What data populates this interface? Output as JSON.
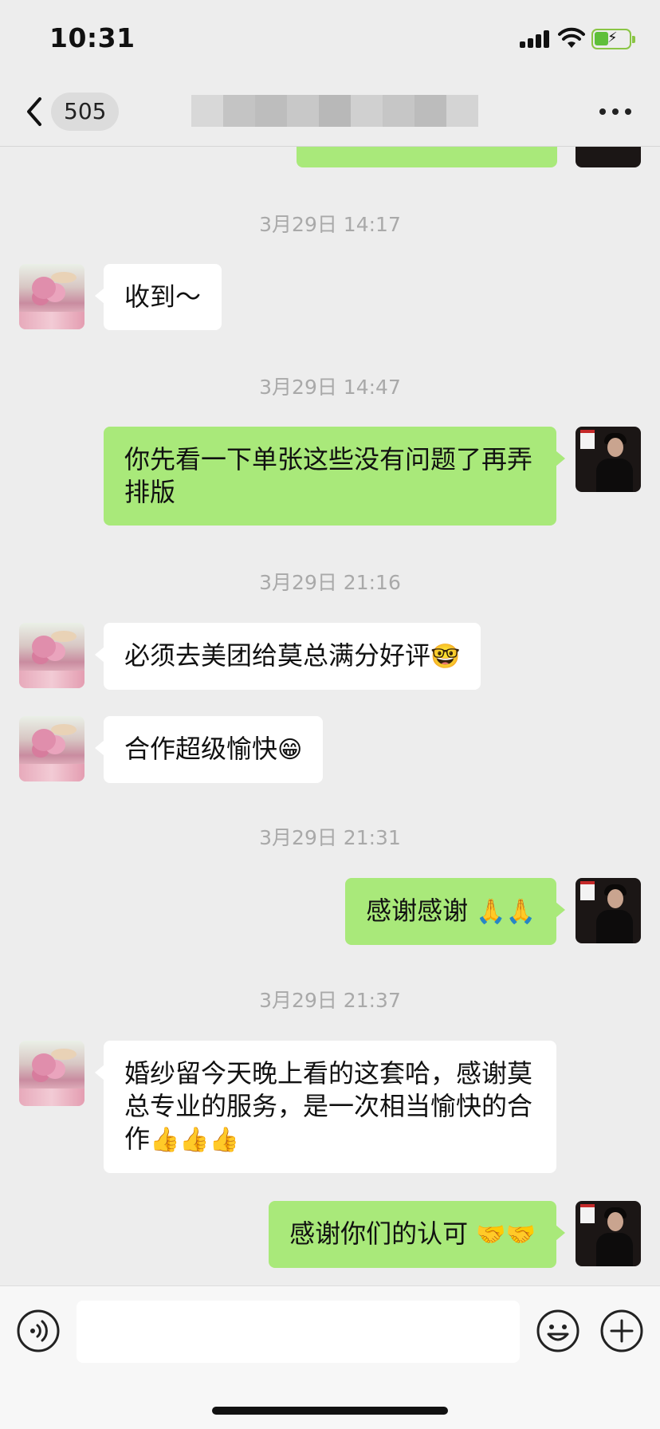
{
  "status_bar": {
    "time": "10:31"
  },
  "nav": {
    "unread_count": "505",
    "more_icon": "more-dots-icon",
    "back_icon": "chevron-left-icon"
  },
  "messages": [
    {
      "type": "timestamp",
      "text": "3月29日 14:17"
    },
    {
      "type": "incoming",
      "text": "收到～"
    },
    {
      "type": "timestamp",
      "text": "3月29日 14:47"
    },
    {
      "type": "outgoing",
      "text": "你先看一下单张这些没有问题了再弄排版"
    },
    {
      "type": "timestamp",
      "text": "3月29日 21:16"
    },
    {
      "type": "incoming",
      "text": "必须去美团给莫总满分好评",
      "emoji": "🤓"
    },
    {
      "type": "incoming",
      "text": "合作超级愉快",
      "emoji": "😁"
    },
    {
      "type": "timestamp",
      "text": "3月29日 21:31"
    },
    {
      "type": "outgoing",
      "text": "感谢感谢 ",
      "emoji": "🙏🙏"
    },
    {
      "type": "timestamp",
      "text": "3月29日 21:37"
    },
    {
      "type": "incoming",
      "text": "婚纱留今天晚上看的这套哈，感谢莫总专业的服务，是一次相当愉快的合作",
      "emoji": "👍👍👍"
    },
    {
      "type": "outgoing",
      "text": "感谢你们的认可 ",
      "emoji": "🤝🤝"
    }
  ],
  "input_bar": {
    "placeholder": "",
    "voice_icon": "voice-icon",
    "emoji_icon": "emoji-icon",
    "plus_icon": "plus-icon"
  },
  "colors": {
    "background": "#ededed",
    "outgoing_bubble": "#a9e97a",
    "incoming_bubble": "#ffffff",
    "timestamp": "#a9a9a9"
  }
}
